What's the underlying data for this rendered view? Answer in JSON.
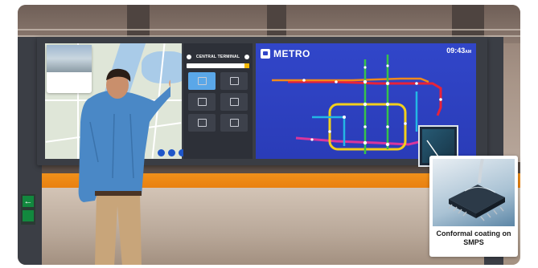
{
  "terminal_panel": {
    "title": "CENTRAL TERMINAL"
  },
  "metro_board": {
    "title": "METRO",
    "clock": "09:43",
    "clock_suffix": "AM"
  },
  "callout": {
    "caption_line1": "Conformal coating on",
    "caption_line2": "SMPS"
  },
  "colors": {
    "metro_background": "#3146c9",
    "platform_stripe": "#e67a0c",
    "map_button": "#1f56c8",
    "line_red": "#e8223a",
    "line_orange": "#f08a1c",
    "line_yellow": "#f2cf1c",
    "line_green": "#37c24a",
    "line_cyan": "#23b7e5",
    "line_magenta": "#d9369c"
  },
  "icons": {
    "metro_logo": "train-icon",
    "exit_sign": "emergency-exit-icon"
  }
}
